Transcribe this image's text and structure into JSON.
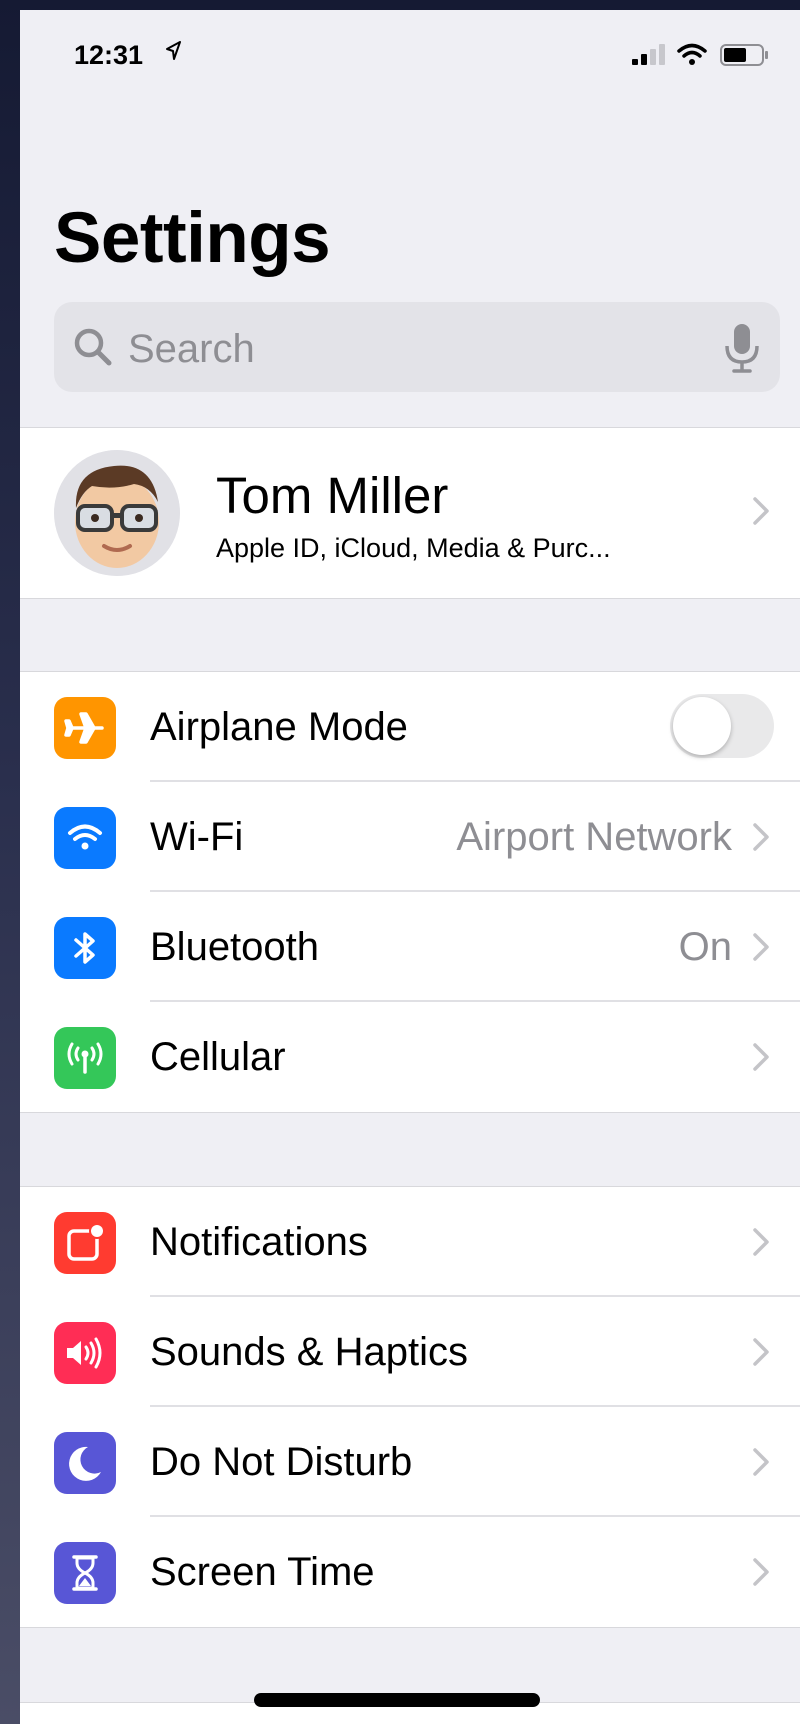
{
  "status_bar": {
    "time": "12:31"
  },
  "header": {
    "title": "Settings"
  },
  "search": {
    "placeholder": "Search"
  },
  "profile": {
    "name": "Tom Miller",
    "subtitle": "Apple ID, iCloud, Media & Purc..."
  },
  "connectivity": [
    {
      "label": "Airplane Mode",
      "icon": "airplane-icon",
      "color": "#ff9500",
      "toggle": false
    },
    {
      "label": "Wi-Fi",
      "value": "Airport Network",
      "icon": "wifi-icon",
      "color": "#0a7aff"
    },
    {
      "label": "Bluetooth",
      "value": "On",
      "icon": "bluetooth-icon",
      "color": "#0a7aff"
    },
    {
      "label": "Cellular",
      "icon": "cellular-icon",
      "color": "#34c759"
    }
  ],
  "system": [
    {
      "label": "Notifications",
      "icon": "notifications-icon",
      "color": "#ff3b30"
    },
    {
      "label": "Sounds & Haptics",
      "icon": "speaker-icon",
      "color": "#ff2d55"
    },
    {
      "label": "Do Not Disturb",
      "icon": "moon-icon",
      "color": "#5856d6"
    },
    {
      "label": "Screen Time",
      "icon": "hourglass-icon",
      "color": "#5856d6"
    }
  ]
}
